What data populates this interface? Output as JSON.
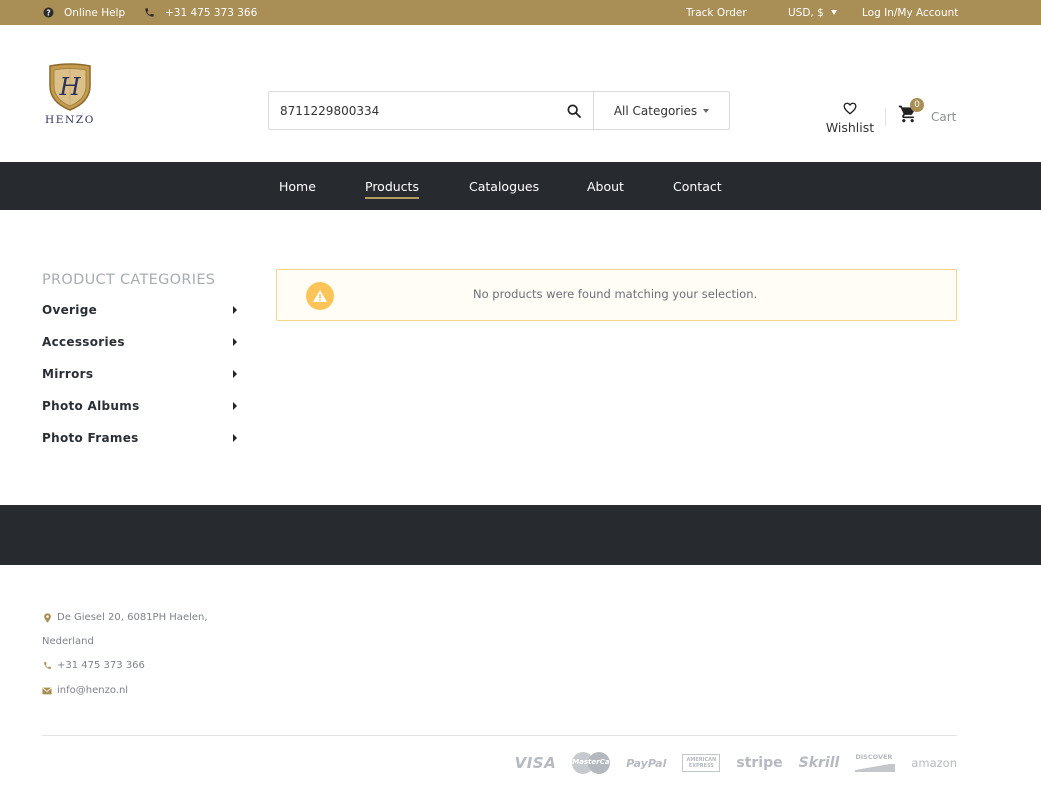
{
  "topbar": {
    "help_label": "Online Help",
    "phone": "+31 475 373 366",
    "track_order": "Track Order",
    "currency": "USD, $",
    "account": "Log In/My Account"
  },
  "brand": {
    "name": "HENZO"
  },
  "search": {
    "value": "8711229800334",
    "category": "All Categories"
  },
  "header": {
    "wishlist_label": "Wishlist",
    "cart_label": "Cart",
    "cart_count": "0"
  },
  "nav": {
    "items": [
      {
        "label": "Home",
        "active": false
      },
      {
        "label": "Products",
        "active": true
      },
      {
        "label": "Catalogues",
        "active": false
      },
      {
        "label": "About",
        "active": false
      },
      {
        "label": "Contact",
        "active": false
      }
    ]
  },
  "sidebar": {
    "title": "PRODUCT CATEGORIES",
    "items": [
      {
        "label": "Overige"
      },
      {
        "label": "Accessories"
      },
      {
        "label": "Mirrors"
      },
      {
        "label": "Photo Albums"
      },
      {
        "label": "Photo Frames"
      }
    ]
  },
  "notice": {
    "text": "No products were found matching your selection."
  },
  "footer": {
    "address_line1": "De Giesel 20, 6081PH Haelen,",
    "address_line2": "Nederland",
    "phone": "+31 475 373 366",
    "email": "info@henzo.nl",
    "payments": [
      "VISA",
      "MasterCard",
      "PayPal",
      "AMERICAN EXPRESS",
      "stripe",
      "Skrill",
      "DISCOVER",
      "amazon"
    ]
  },
  "colors": {
    "brand_gold": "#a98e55",
    "nav_dark": "#272b30",
    "warning_yellow": "#fdc45a"
  }
}
